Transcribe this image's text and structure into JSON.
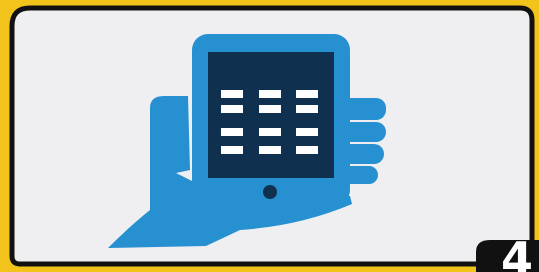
{
  "graphic": {
    "icon": "hand-holding-tablet-icon",
    "frame_color": "#f2c31a",
    "card_color": "#efeff1",
    "border_color": "#111111",
    "hand_color": "#2690d1",
    "tablet_color": "#2690d1",
    "screen_color": "#10304f",
    "grid_color": "#ffffff",
    "screen_grid": {
      "rows": 4,
      "columns": 3
    }
  },
  "badge": {
    "label": "4",
    "background": "#111111",
    "text_color": "#ffffff"
  }
}
